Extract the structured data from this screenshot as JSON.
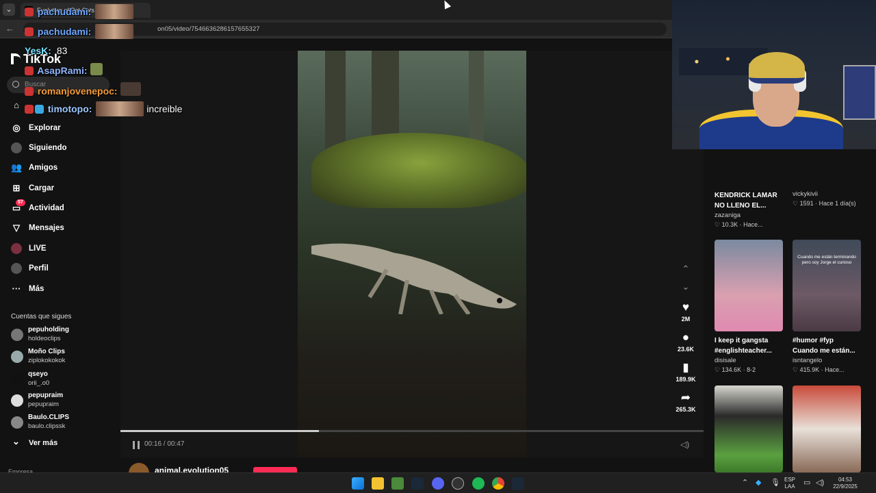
{
  "browser": {
    "tab_title": "Evolution of Pet Cats",
    "url": "on05/video/7546636286157655327"
  },
  "sidebar": {
    "logo": "TikTok",
    "search_placeholder": "Buscar",
    "nav": [
      {
        "label": "Explorar",
        "icon": "compass-icon"
      },
      {
        "label": "Siguiendo",
        "icon": "following-icon"
      },
      {
        "label": "Amigos",
        "icon": "friends-icon"
      },
      {
        "label": "Cargar",
        "icon": "upload-icon"
      },
      {
        "label": "Actividad",
        "icon": "activity-icon",
        "badge": "57"
      },
      {
        "label": "Mensajes",
        "icon": "messages-icon"
      },
      {
        "label": "LIVE",
        "icon": "live-icon"
      },
      {
        "label": "Perfil",
        "icon": "profile-icon"
      },
      {
        "label": "Más",
        "icon": "more-icon"
      }
    ],
    "following_title": "Cuentas que sigues",
    "following": [
      {
        "name": "pepuholding",
        "user": "holdeoclips"
      },
      {
        "name": "Moño Clips",
        "user": "ziplokokokok"
      },
      {
        "name": "qseyo",
        "user": "orii_.o0"
      },
      {
        "name": "pepupraim",
        "user": "pepupraim"
      },
      {
        "name": "Baulo.CLIPS",
        "user": "baulo.clipssk"
      }
    ],
    "see_more": "Ver más",
    "others": "Empresa"
  },
  "player": {
    "time": "00:16 / 00:47",
    "progress": 0.34,
    "author": "animal.evolution05",
    "actions": [
      {
        "icon": "heart-icon",
        "count": "2M"
      },
      {
        "icon": "comment-icon",
        "count": "23.6K"
      },
      {
        "icon": "bookmark-icon",
        "count": "189.9K"
      },
      {
        "icon": "share-icon",
        "count": "265.3K"
      }
    ]
  },
  "related": [
    {
      "title1": "KENDRICK LAMAR",
      "title2": "NO LLENO EL...",
      "author": "zazaniga",
      "stats": "10.3K · Hace..."
    },
    {
      "title1": "",
      "title2": "",
      "author": "vickykivii",
      "stats": "1591 · Hace 1 día(s)"
    },
    {
      "title1": "I keep it gangsta",
      "title2": "#englishteacher...",
      "author": "disisale",
      "stats": "134.6K · 8-2"
    },
    {
      "title1": "#humor #fyp",
      "title2": "Cuando me están...",
      "author": "isntangelo",
      "stats": "415.9K · Hace...",
      "thumb_text": "Cuando me están terminando pero soy Jorge el curioso"
    },
    {
      "title1": "",
      "title2": "",
      "author": "",
      "stats": ""
    },
    {
      "title1": "",
      "title2": "",
      "author": "",
      "stats": ""
    }
  ],
  "chat": [
    {
      "name": "pachudami:",
      "color": "#6fa8ff",
      "msg": ""
    },
    {
      "name": "pachudami:",
      "color": "#6fa8ff",
      "msg": ""
    },
    {
      "name": "YesK:",
      "color": "#7be0ff",
      "msg": "83"
    },
    {
      "name": "AsapRami:",
      "color": "#8fb5ff",
      "msg": ""
    },
    {
      "name": "romanjovenepoc:",
      "color": "#f39a3a",
      "msg": ""
    },
    {
      "name": "timotopo:",
      "color": "#9ec8ff",
      "msg": "increible"
    }
  ],
  "taskbar": {
    "lang1": "ESP",
    "lang2": "LAA",
    "time": "04:53",
    "date": "22/9/2025"
  },
  "colors": {
    "accent": "#fe2c55",
    "bg": "#121212"
  }
}
